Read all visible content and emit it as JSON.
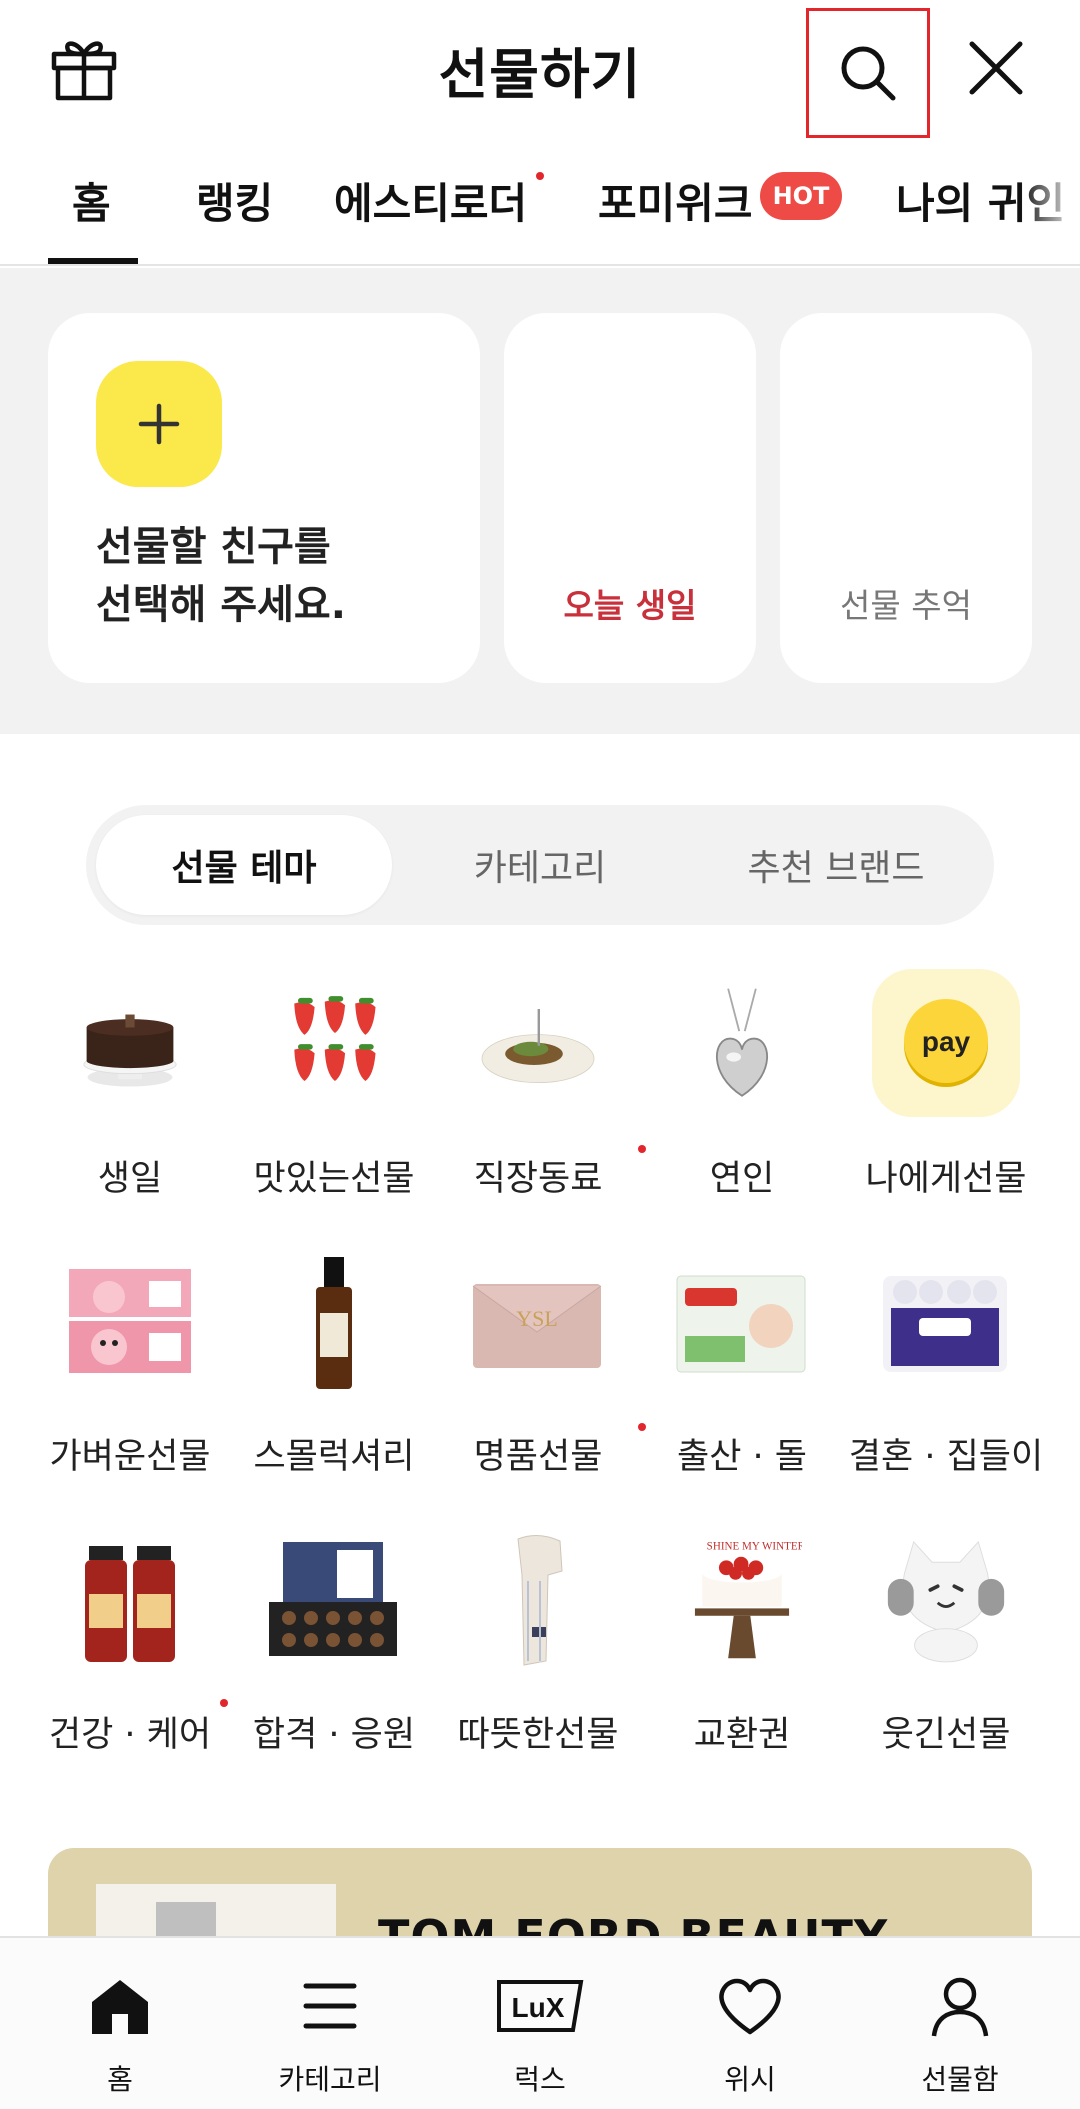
{
  "header": {
    "title": "선물하기",
    "icons": {
      "left": "gift-icon",
      "search": "search-icon",
      "close": "close-icon"
    }
  },
  "tabs": [
    {
      "label": "홈",
      "active": true
    },
    {
      "label": "랭킹"
    },
    {
      "label": "에스티로더",
      "new_dot": true
    },
    {
      "label": "포미위크",
      "badge": "HOT"
    },
    {
      "label": "나의 귀인"
    }
  ],
  "friend_section": {
    "main_text_line1": "선물할 친구를",
    "main_text_line2": "선택해 주세요.",
    "plus_icon": "plus-icon",
    "birthday_label": "오늘 생일",
    "memory_label": "선물 추억",
    "accent_color": "#fbe84a"
  },
  "segment": {
    "items": [
      "선물 테마",
      "카테고리",
      "추천 브랜드"
    ],
    "active_index": 0
  },
  "themes": [
    {
      "label": "생일",
      "icon": "cake-icon"
    },
    {
      "label": "맛있는선물",
      "icon": "strawberry-icon"
    },
    {
      "label": "직장동료",
      "icon": "dessert-icon",
      "new_dot": true
    },
    {
      "label": "연인",
      "icon": "heart-necklace-icon"
    },
    {
      "label": "나에게선물",
      "icon": "pay-coin-icon"
    },
    {
      "label": "가벼운선물",
      "icon": "character-box-icon"
    },
    {
      "label": "스몰럭셔리",
      "icon": "perfume-bottle-icon"
    },
    {
      "label": "명품선물",
      "icon": "wallet-icon",
      "new_dot": true
    },
    {
      "label": "출산 · 돌",
      "icon": "diaper-box-icon"
    },
    {
      "label": "결혼 · 집들이",
      "icon": "tissue-pack-icon"
    },
    {
      "label": "건강 · 케어",
      "icon": "health-drink-icon",
      "new_dot": true
    },
    {
      "label": "합격 · 응원",
      "icon": "chocolate-box-icon"
    },
    {
      "label": "따뜻한선물",
      "icon": "scarf-icon"
    },
    {
      "label": "교환권",
      "icon": "cake-stand-icon"
    },
    {
      "label": "웃긴선물",
      "icon": "cat-plush-icon"
    }
  ],
  "banner": {
    "title": "TOM FORD BEAUTY"
  },
  "bottom_nav": [
    {
      "label": "홈",
      "icon": "home-icon"
    },
    {
      "label": "카테고리",
      "icon": "menu-icon"
    },
    {
      "label": "럭스",
      "icon": "lux-icon"
    },
    {
      "label": "위시",
      "icon": "heart-icon"
    },
    {
      "label": "선물함",
      "icon": "person-icon"
    }
  ]
}
